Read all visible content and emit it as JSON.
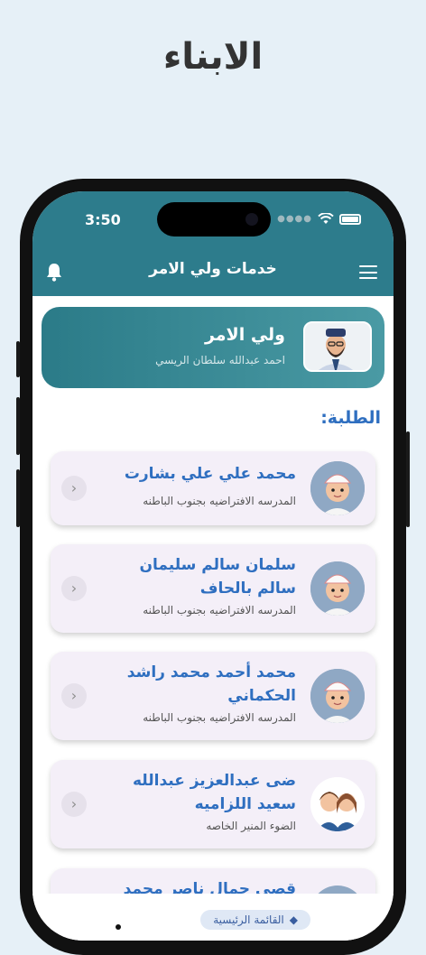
{
  "page": {
    "heading": "الابناء"
  },
  "status": {
    "time": "3:50"
  },
  "appbar": {
    "title": "خدمات ولي الامر"
  },
  "guardian": {
    "title": "ولي الامر",
    "name": "احمد عبدالله سلطان الريسي"
  },
  "students_heading": "الطلبة:",
  "students": [
    {
      "name": "محمد علي علي بشارت",
      "school": "المدرسه الافتراضيه بجنوب الباطنه"
    },
    {
      "name": "سلمان سالم سليمان سالم بالحاف",
      "school": "المدرسه الافتراضيه بجنوب الباطنه"
    },
    {
      "name": "محمد أحمد محمد راشد الحكماني",
      "school": "المدرسه الافتراضيه بجنوب الباطنه"
    },
    {
      "name": "ضى عبدالعزيز عبدالله سعيد اللزاميه",
      "school": "الضوء المنير الخاصه"
    },
    {
      "name": "قصي جمال ناصر محمد",
      "school": ""
    }
  ],
  "bottom_nav": {
    "active_label": "القائمة الرئيسية"
  },
  "colors": {
    "appbar": "#2d7c8c",
    "accent": "#2f6fc0",
    "card": "#f4eff8",
    "background": "#e6f0f7"
  }
}
